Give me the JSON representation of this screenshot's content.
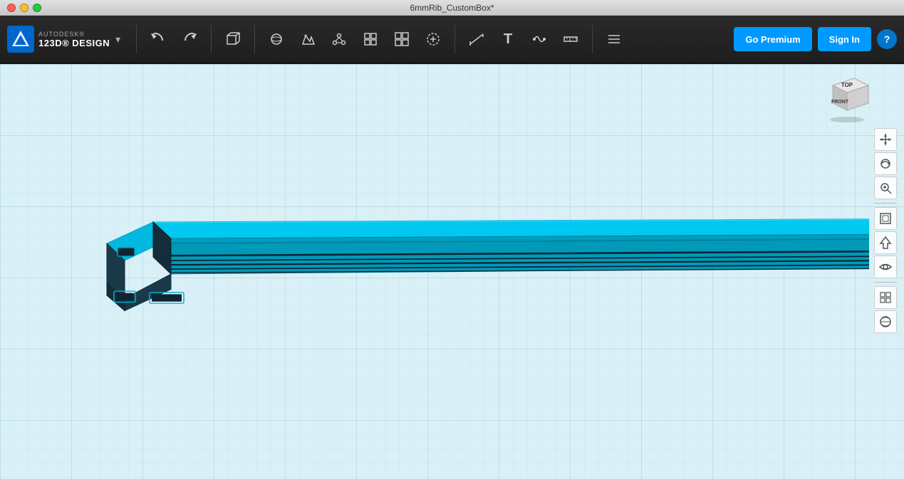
{
  "titlebar": {
    "title": "6mmRib_CustomBox*",
    "buttons": {
      "close": "close",
      "minimize": "minimize",
      "maximize": "maximize"
    }
  },
  "app": {
    "brand": "AUTODESK®",
    "product": "123D® DESIGN",
    "dropdown_icon": "▾"
  },
  "toolbar": {
    "undo_label": "←",
    "redo_label": "→",
    "tools": [
      {
        "name": "box-tool",
        "icon": "⬜",
        "label": "Box"
      },
      {
        "name": "primitives-tool",
        "icon": "⬡",
        "label": "Primitives"
      },
      {
        "name": "sketch-tool",
        "icon": "✏",
        "label": "Sketch"
      },
      {
        "name": "construct-tool",
        "icon": "⬧",
        "label": "Construct"
      },
      {
        "name": "modify-tool",
        "icon": "⧉",
        "label": "Modify"
      },
      {
        "name": "pattern-tool",
        "icon": "⊞",
        "label": "Pattern"
      },
      {
        "name": "group-tool",
        "icon": "⊕",
        "label": "Group"
      },
      {
        "name": "measure-tool",
        "icon": "📏",
        "label": "Measure"
      },
      {
        "name": "text-tool",
        "icon": "T",
        "label": "Text"
      },
      {
        "name": "snap-tool",
        "icon": "🔗",
        "label": "Snap"
      },
      {
        "name": "ruler-tool",
        "icon": "📐",
        "label": "Ruler"
      },
      {
        "name": "layers-tool",
        "icon": "☰",
        "label": "Layers"
      }
    ],
    "go_premium_label": "Go Premium",
    "sign_in_label": "Sign In",
    "help_label": "?"
  },
  "viewport": {
    "background_color": "#daf0f7",
    "grid_color": "#b0dde8"
  },
  "viewcube": {
    "top_label": "TOP",
    "front_label": "FRONT"
  },
  "right_toolbar": {
    "buttons": [
      {
        "name": "pan-tool",
        "icon": "✛",
        "label": "Pan"
      },
      {
        "name": "orbit-tool",
        "icon": "↻",
        "label": "Orbit"
      },
      {
        "name": "zoom-tool",
        "icon": "⌕",
        "label": "Zoom"
      },
      {
        "name": "fit-tool",
        "icon": "⊡",
        "label": "Fit"
      },
      {
        "name": "home-view",
        "icon": "⬡",
        "label": "Home"
      },
      {
        "name": "eye-tool",
        "icon": "◉",
        "label": "View"
      },
      {
        "name": "grid-toggle",
        "icon": "⊞",
        "label": "Grid"
      },
      {
        "name": "material-tool",
        "icon": "⬥",
        "label": "Material"
      }
    ]
  }
}
